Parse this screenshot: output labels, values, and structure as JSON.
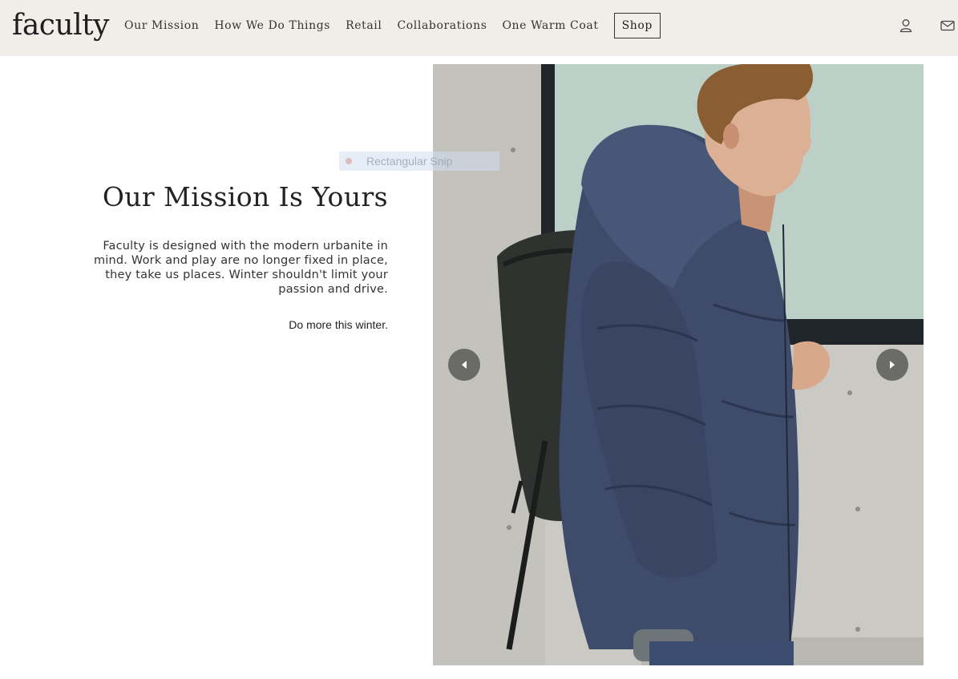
{
  "header": {
    "logo": "faculty",
    "nav": [
      {
        "label": "Our Mission"
      },
      {
        "label": "How We Do Things"
      },
      {
        "label": "Retail"
      },
      {
        "label": "Collaborations"
      },
      {
        "label": "One Warm Coat"
      }
    ],
    "shop_label": "Shop",
    "icons": [
      "account-icon",
      "mail-icon"
    ]
  },
  "hero": {
    "title": "Our Mission Is Yours",
    "body": "Faculty is designed with the modern urbanite in mind. Work and play are no longer fixed in place, they take us places. Winter shouldn't limit your passion and drive.",
    "tagline": "Do more this winter."
  },
  "overlay": {
    "snip_label": "Rectangular Snip"
  },
  "carousel": {
    "prev_icon": "chevron-left-icon",
    "next_icon": "chevron-right-icon"
  }
}
